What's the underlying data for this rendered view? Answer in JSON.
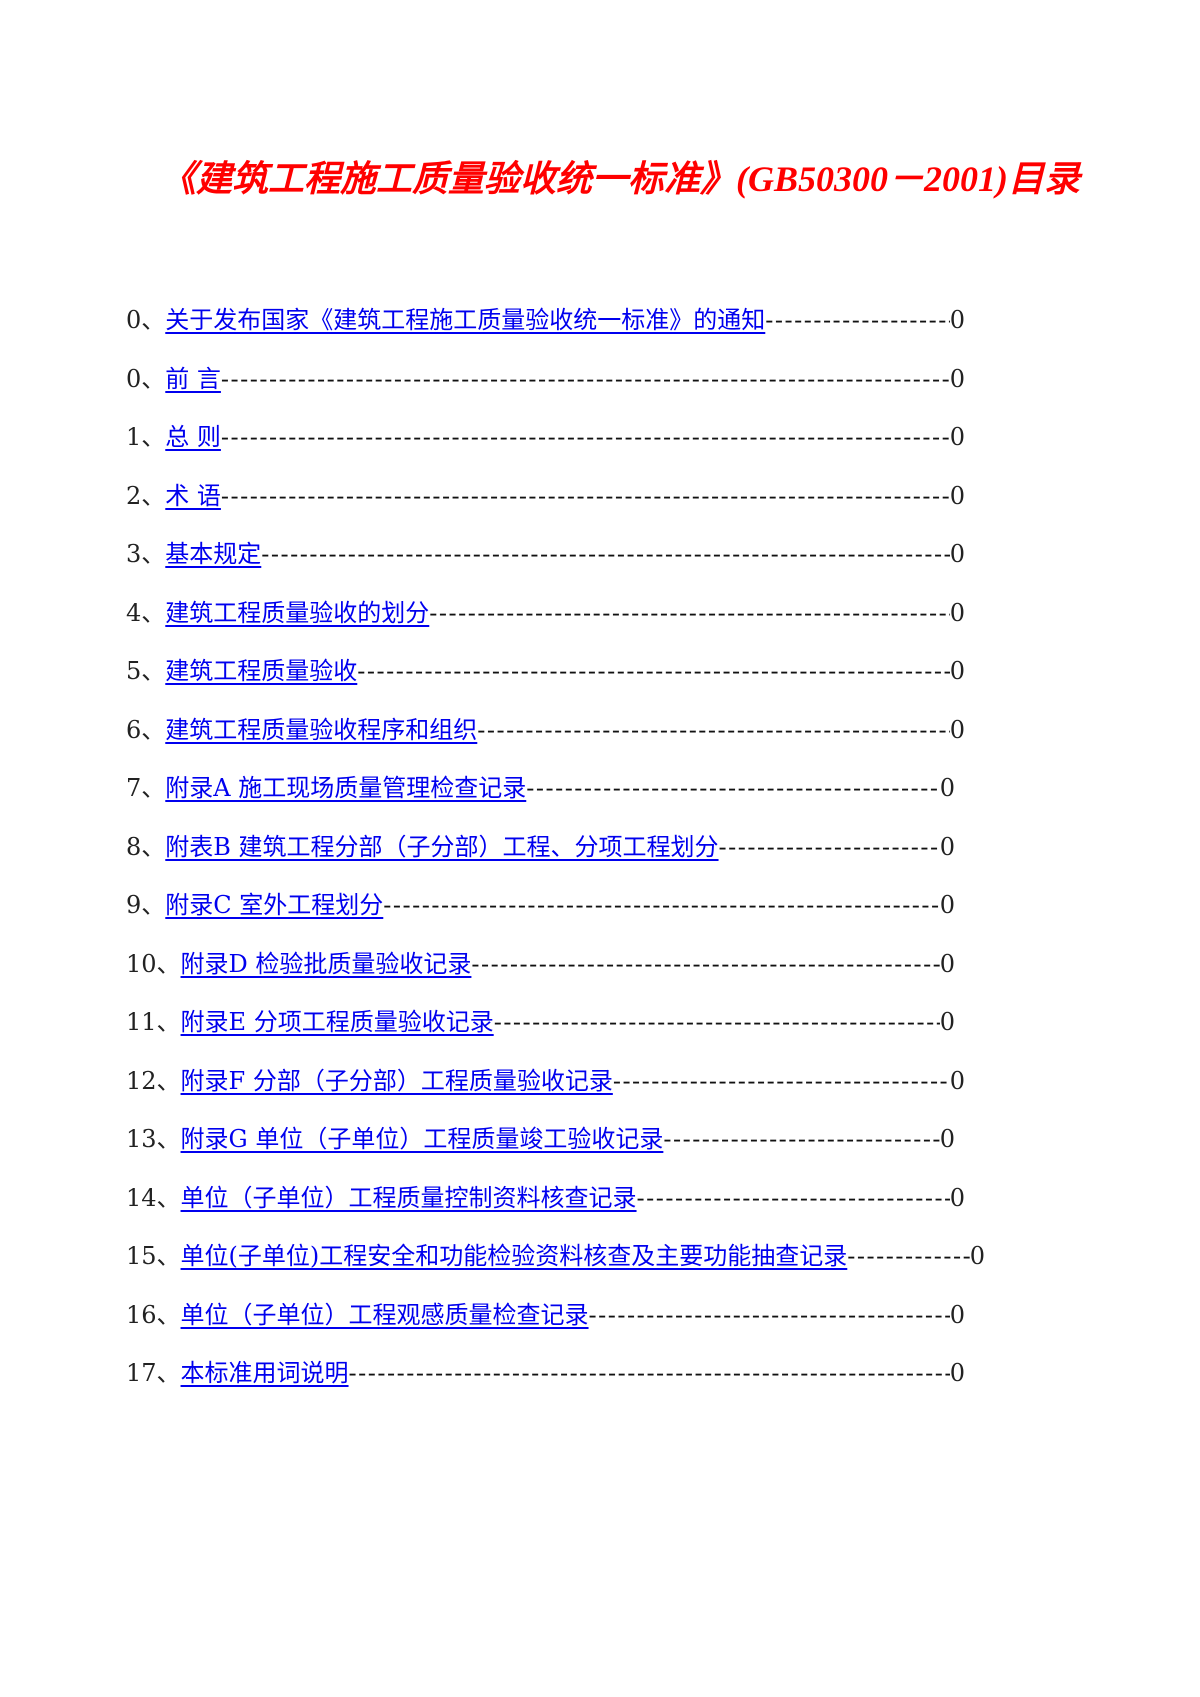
{
  "document": {
    "title": "《建筑工程施工质量验收统一标准》(GB50300－2001)目录",
    "accent_color": "#ff0000",
    "link_color": "#0000ee",
    "toc": [
      {
        "num": "0、",
        "label": "关于发布国家《建筑工程施工质量验收统一标准》的通知",
        "page": "0"
      },
      {
        "num": "0、",
        "label": "前  言",
        "page": "0"
      },
      {
        "num": "1、",
        "label": "总  则",
        "page": "0"
      },
      {
        "num": "2、",
        "label": "术  语",
        "page": "0"
      },
      {
        "num": "3、",
        "label": "基本规定",
        "page": "0"
      },
      {
        "num": "4、",
        "label": "建筑工程质量验收的划分",
        "page": "0"
      },
      {
        "num": "5、",
        "label": "建筑工程质量验收",
        "page": "0"
      },
      {
        "num": "6、",
        "label": "建筑工程质量验收程序和组织",
        "page": "0"
      },
      {
        "num": "7、",
        "label": "附录A  施工现场质量管理检查记录",
        "page": "0"
      },
      {
        "num": "8、",
        "label": "附表B  建筑工程分部（子分部）工程、分项工程划分",
        "page": "0"
      },
      {
        "num": "9、",
        "label": "附录C  室外工程划分",
        "page": "0"
      },
      {
        "num": "10、",
        "label": "附录D  检验批质量验收记录",
        "page": "0"
      },
      {
        "num": "11、",
        "label": "附录E  分项工程质量验收记录",
        "page": "0"
      },
      {
        "num": "12、",
        "label": "附录F  分部（子分部）工程质量验收记录",
        "page": "0"
      },
      {
        "num": "13、",
        "label": "附录G  单位（子单位）工程质量竣工验收记录",
        "page": "0"
      },
      {
        "num": "14、",
        "label": "单位（子单位）工程质量控制资料核查记录",
        "page": "0"
      },
      {
        "num": "15、",
        "label": "单位(子单位)工程安全和功能检验资料核查及主要功能抽查记录",
        "page": "0"
      },
      {
        "num": "16、",
        "label": "单位（子单位）工程观感质量检查记录",
        "page": "0"
      },
      {
        "num": "17、",
        "label": "本标准用词说明",
        "page": "0"
      }
    ]
  }
}
